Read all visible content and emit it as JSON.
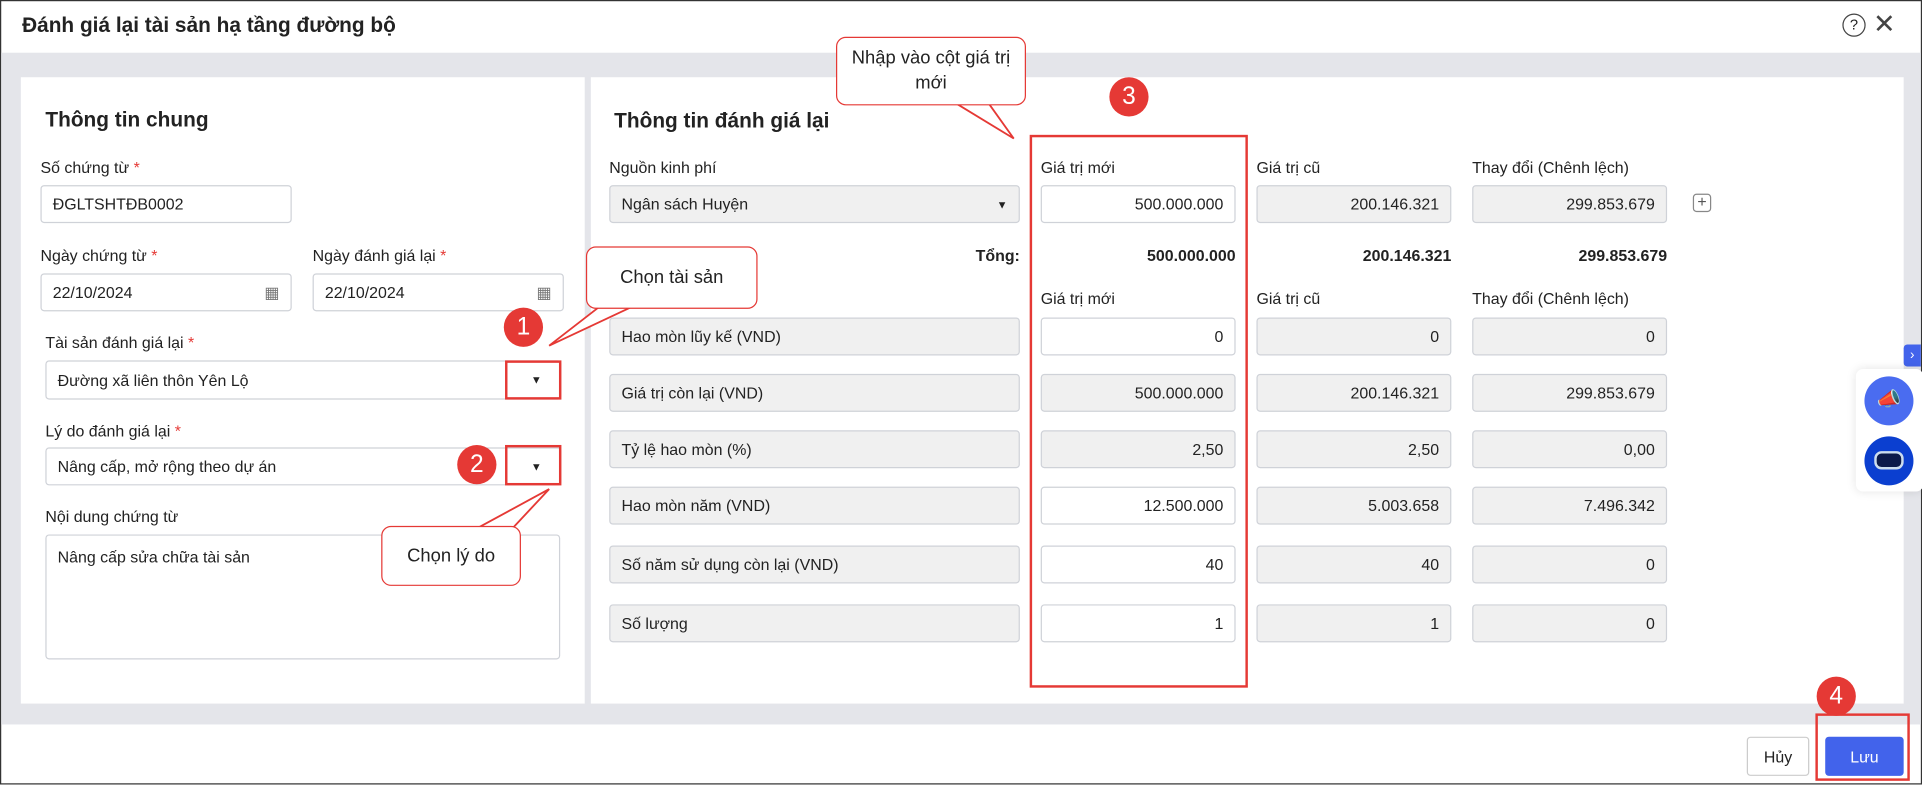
{
  "title": "Đánh giá lại tài sản hạ tầng đường bộ",
  "left": {
    "heading": "Thông tin chung",
    "so_chung_tu_label": "Số chứng từ",
    "so_chung_tu": "ĐGLTSHTĐB0002",
    "ngay_chung_tu_label": "Ngày chứng từ",
    "ngay_chung_tu": "22/10/2024",
    "ngay_danh_gia_label": "Ngày đánh giá lại",
    "ngay_danh_gia": "22/10/2024",
    "tai_san_label": "Tài sản đánh giá lại",
    "tai_san": "Đường xã liên thôn Yên Lộ",
    "ly_do_label": "Lý do đánh giá lại",
    "ly_do": "Nâng cấp, mở rộng theo dự án",
    "noi_dung_label": "Nội dung chứng từ",
    "noi_dung": "Nâng cấp sửa chữa tài sản",
    "req": "*"
  },
  "right": {
    "heading": "Thông tin đánh giá lại",
    "nguon_label": "Nguồn kinh phí",
    "nguon": "Ngân sách Huyện",
    "col_new": "Giá trị mới",
    "col_old": "Giá trị cũ",
    "col_diff": "Thay đổi (Chênh lệch)",
    "source_row": {
      "new": "500.000.000",
      "old": "200.146.321",
      "diff": "299.853.679"
    },
    "total_label": "Tổng:",
    "total": {
      "new": "500.000.000",
      "old": "200.146.321",
      "diff": "299.853.679"
    },
    "rows": [
      {
        "label": "Hao mòn lũy kế (VND)",
        "new": "0",
        "old": "0",
        "diff": "0"
      },
      {
        "label": "Giá trị còn lại (VND)",
        "new": "500.000.000",
        "old": "200.146.321",
        "diff": "299.853.679"
      },
      {
        "label": "Tỷ lệ hao mòn (%)",
        "new": "2,50",
        "old": "2,50",
        "diff": "0,00"
      },
      {
        "label": "Hao mòn năm (VND)",
        "new": "12.500.000",
        "old": "5.003.658",
        "diff": "7.496.342"
      },
      {
        "label": "Số năm sử dụng còn lại (VND)",
        "new": "40",
        "old": "40",
        "diff": "0"
      },
      {
        "label": "Số lượng",
        "new": "1",
        "old": "1",
        "diff": "0"
      }
    ]
  },
  "footer": {
    "cancel": "Hủy",
    "save": "Lưu"
  },
  "annotations": {
    "c1": "Chọn tài sản",
    "c2": "Chọn lý do",
    "c3": "Nhập vào cột giá trị mới",
    "b1": "1",
    "b2": "2",
    "b3": "3",
    "b4": "4"
  },
  "colors": {
    "accent": "#4263eb",
    "annotation": "#e53935"
  }
}
